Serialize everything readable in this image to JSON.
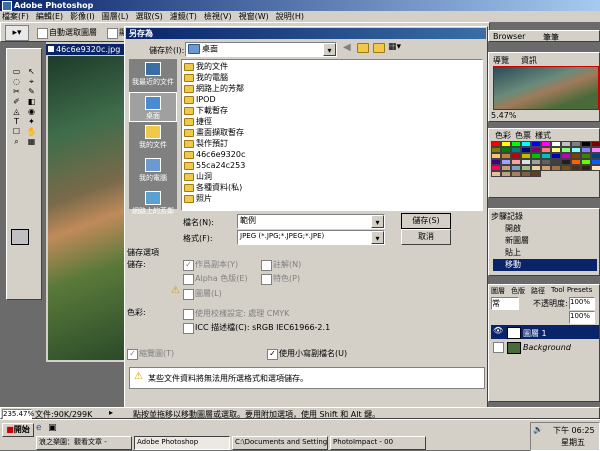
{
  "titlebar": {
    "title": "Adobe Photoshop"
  },
  "menubar": [
    "檔案(F)",
    "編輯(E)",
    "影像(I)",
    "圖層(L)",
    "選取(S)",
    "濾鏡(T)",
    "檢視(V)",
    "視窗(W)",
    "說明(H)"
  ],
  "options": {
    "auto_select": "自動選取圖層",
    "show": "顯示"
  },
  "doc_tab": "46c6e9320c.jpg",
  "right_tabs": {
    "browser": "Browser",
    "brush": "筆筆"
  },
  "navigator": {
    "tabs": [
      "導覽",
      "資訊"
    ],
    "zoom": "5.47%"
  },
  "swatch_tabs": [
    "色彩",
    "色票",
    "樣式"
  ],
  "history": {
    "tab": "步驟記錄",
    "items": [
      "開啟",
      "新圖層",
      "貼上",
      "移動"
    ],
    "selected": 3
  },
  "layers": {
    "tabs": [
      "圖層",
      "色版",
      "路徑",
      "Tool Presets"
    ],
    "blend": "常",
    "opacity_label": "不透明度:",
    "opacity": "100%",
    "fill": "100%",
    "rows": [
      "圖層 1",
      "Background"
    ]
  },
  "dialog": {
    "title": "另存為",
    "save_in_label": "儲存於(I):",
    "save_in_value": "桌面",
    "places": [
      "我最近的文件",
      "桌面",
      "我的文件",
      "我的電腦",
      "網路上的芳鄰"
    ],
    "files": [
      "我的文件",
      "我的電腦",
      "網路上的芳鄰",
      "IPOD",
      "下載暫存",
      "捷徑",
      "畫面擷取暫存",
      "製作預訂",
      "46c6e9320c",
      "55ca24c253",
      "山洞",
      "各種資料(私)",
      "照片"
    ],
    "filename_label": "檔名(N):",
    "filename": "範例",
    "format_label": "格式(F):",
    "format": "JPEG (*.JPG;*.JPEG;*.JPE)",
    "save_button": "儲存(S)",
    "cancel_button": "取消",
    "section_title": "儲存選項",
    "save_label": "儲存:",
    "opt_copy": "作爲副本(Y)",
    "opt_notes": "註解(N)",
    "opt_alpha": "Alpha 色版(E)",
    "opt_spot": "特色(P)",
    "opt_layers": "圖層(L)",
    "color_label": "色彩:",
    "opt_proof": "使用校樣設定: 處理 CMYK",
    "opt_icc": "ICC 描述檔(C): sRGB IEC61966-2.1",
    "opt_thumb": "縮覽圖(T)",
    "opt_ext": "使用小寫副檔名(U)",
    "warning": "某些文件資料將無法用所選格式和選項儲存。"
  },
  "statusbar": {
    "zoom": "235.47%",
    "doc": "文件:90K/299K",
    "hint": "點按並拖移以移動圖層或選取。要用附加選項，使用 Shift 和 Alt 鍵。"
  },
  "taskbar": {
    "start": "開始",
    "items": [
      "浪之樂園：觀看文章 -",
      "Adobe Photoshop",
      "C:\\Documents and Setting...",
      "PhotoImpact - 00"
    ],
    "time": "下午 06:25",
    "day": "星期五"
  }
}
